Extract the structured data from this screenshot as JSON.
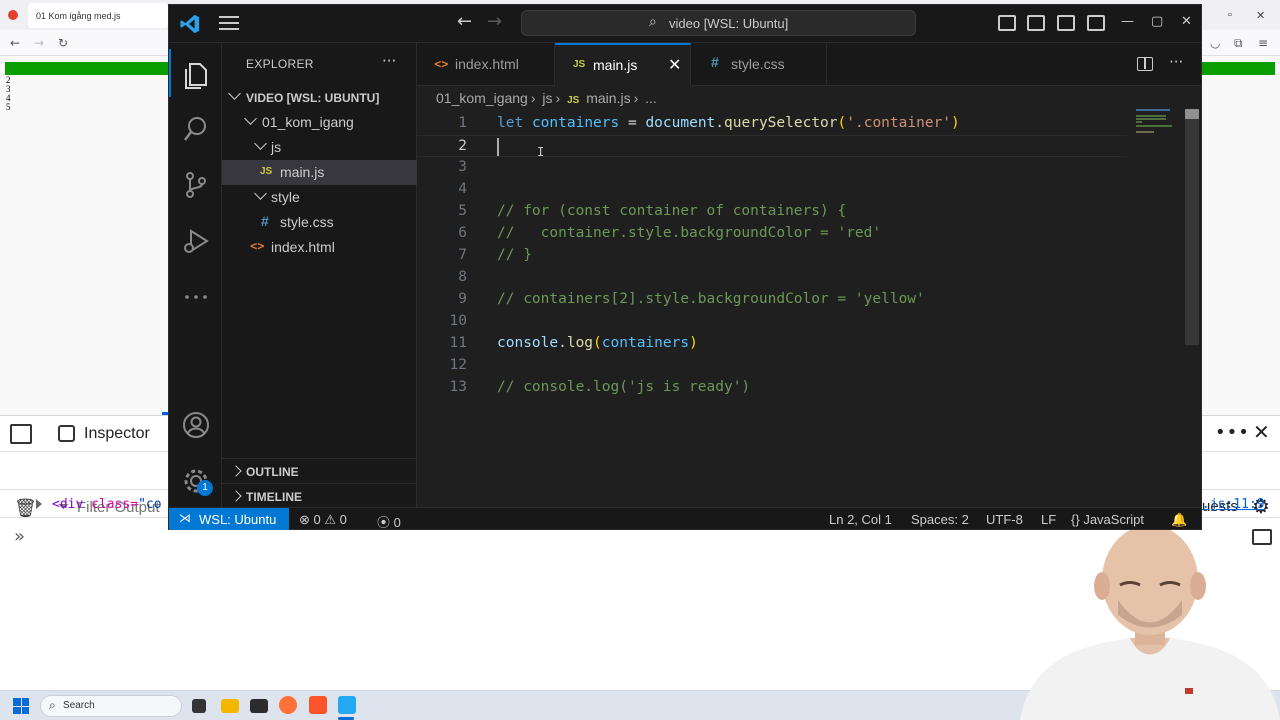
{
  "browser": {
    "tab_title": "01 Kom igång med.js",
    "page_numbers": [
      "2",
      "3",
      "4",
      "5"
    ],
    "devtools": {
      "inspector_label": "Inspector",
      "filter_placeholder": "Filter Output",
      "requests_label": "uests",
      "element_tag": "<div",
      "element_attr": " class=",
      "element_value": "\"co",
      "file_link": ".js:11:9"
    }
  },
  "vscode": {
    "title": "video [WSL: Ubuntu]",
    "explorer_title": "EXPLORER",
    "tree": [
      {
        "label": "VIDEO [WSL: UBUNTU]",
        "kind": "root"
      },
      {
        "label": "01_kom_igang",
        "kind": "folder"
      },
      {
        "label": "js",
        "kind": "folder"
      },
      {
        "label": "main.js",
        "kind": "js"
      },
      {
        "label": "style",
        "kind": "folder"
      },
      {
        "label": "style.css",
        "kind": "css"
      },
      {
        "label": "index.html",
        "kind": "html"
      }
    ],
    "outline_label": "OUTLINE",
    "timeline_label": "TIMELINE",
    "tabs": [
      {
        "label": "index.html",
        "icon": "<>"
      },
      {
        "label": "main.js",
        "icon": "JS"
      },
      {
        "label": "style.css",
        "icon": "#"
      }
    ],
    "breadcrumb": [
      "01_kom_igang",
      "js",
      "main.js",
      "..."
    ],
    "accounts_badge": "1",
    "code_lines": [
      "1",
      "2",
      "3",
      "4",
      "5",
      "6",
      "7",
      "8",
      "9",
      "10",
      "11",
      "12",
      "13"
    ],
    "status": {
      "remote": "WSL: Ubuntu",
      "errors": "0",
      "warnings": "0",
      "ports": "0",
      "position": "Ln 2, Col 1",
      "spaces": "Spaces: 2",
      "encoding": "UTF-8",
      "eol": "LF",
      "language": "JavaScript"
    }
  },
  "taskbar": {
    "search_label": "Search"
  },
  "colors": {
    "accent": "#0078d4",
    "green_bar": "#0a9d00"
  }
}
